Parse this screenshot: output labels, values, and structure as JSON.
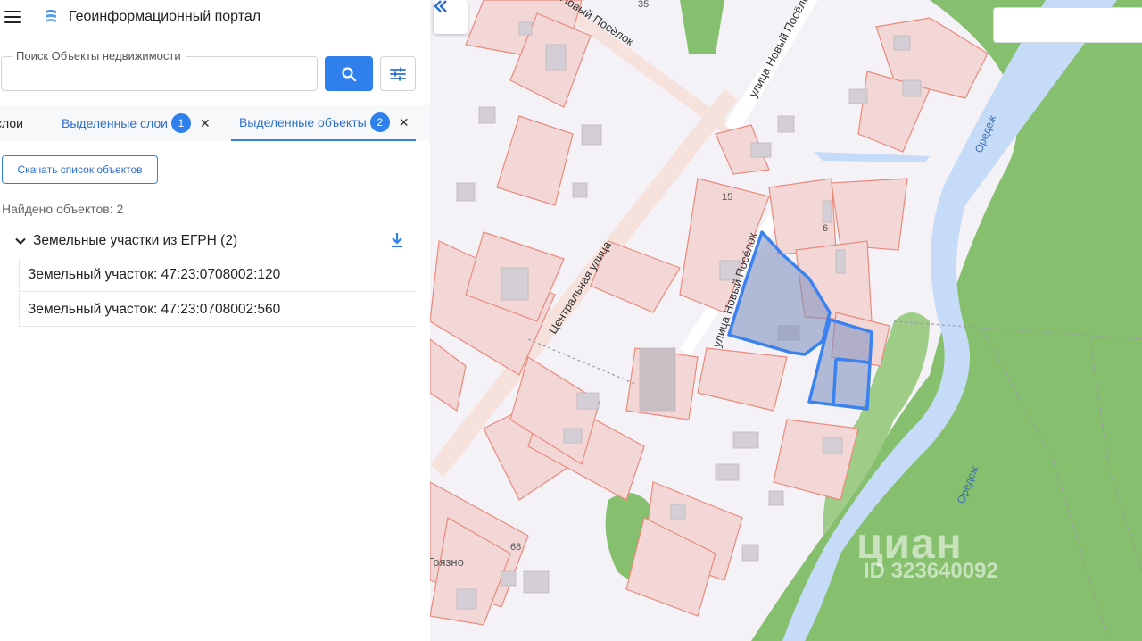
{
  "app": {
    "title": "Геоинформационный портал"
  },
  "search": {
    "label": "Поиск Объекты недвижимости",
    "value": ""
  },
  "tabs": [
    {
      "label": "слои"
    },
    {
      "label": "Выделенные слои",
      "badge": "1",
      "close": "✕"
    },
    {
      "label": "Выделенные объекты",
      "badge": "2",
      "close": "✕"
    }
  ],
  "actions": {
    "download_list": "Скачать список объектов"
  },
  "results": {
    "found_text": "Найдено объектов: 2",
    "group_title": "Земельные участки из ЕГРН (2)",
    "items": [
      {
        "label": "Земельный участок: 47:23:0708002:120"
      },
      {
        "label": "Земельный участок: 47:23:0708002:560"
      }
    ]
  },
  "map": {
    "street_labels": [
      "Центральная улица",
      "улица Новый Посёлок",
      "улица Новый Посёлок",
      "Новый Посёлок",
      "Оредеж",
      "Оредеж"
    ],
    "house_numbers": [
      "35",
      "15",
      "6",
      "68"
    ],
    "place_label": "Грязно",
    "watermark": {
      "brand": "циан",
      "id": "ID 323640092"
    }
  },
  "colors": {
    "accent": "#2f80ed",
    "parcel_fill": "#f3d7d7",
    "parcel_stroke": "#e98a7b",
    "water": "#c6dbf7",
    "forest": "#86bf6d",
    "selected_fill": "#98a9cc",
    "selected_stroke": "#3b82f0"
  }
}
